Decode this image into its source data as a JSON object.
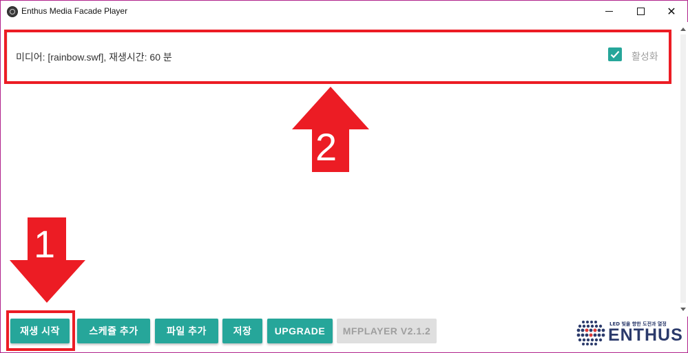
{
  "window": {
    "title": "Enthus Media Facade Player",
    "border_color": "#b0208a"
  },
  "schedule": {
    "media_info": "미디어: [rainbow.swf], 재생시간: 60 분",
    "enabled_label": "활성화",
    "enabled": true
  },
  "annotations": {
    "marker_1": "1",
    "marker_2": "2",
    "highlight_color": "#ec1c24"
  },
  "buttons": {
    "play": "재생 시작",
    "add_schedule": "스케쥴 추가",
    "add_file": "파일 추가",
    "save": "저장",
    "upgrade": "UPGRADE",
    "version": "MFPLAYER V2.1.2"
  },
  "logo": {
    "tagline": "LED 빛을 향한 도전과 열정",
    "wordmark": "ENTHUS"
  },
  "colors": {
    "accent": "#26a69a",
    "disabled_bg": "#dfdfdf",
    "disabled_text": "#9e9e9e",
    "logo_blue": "#2b3a6b"
  }
}
